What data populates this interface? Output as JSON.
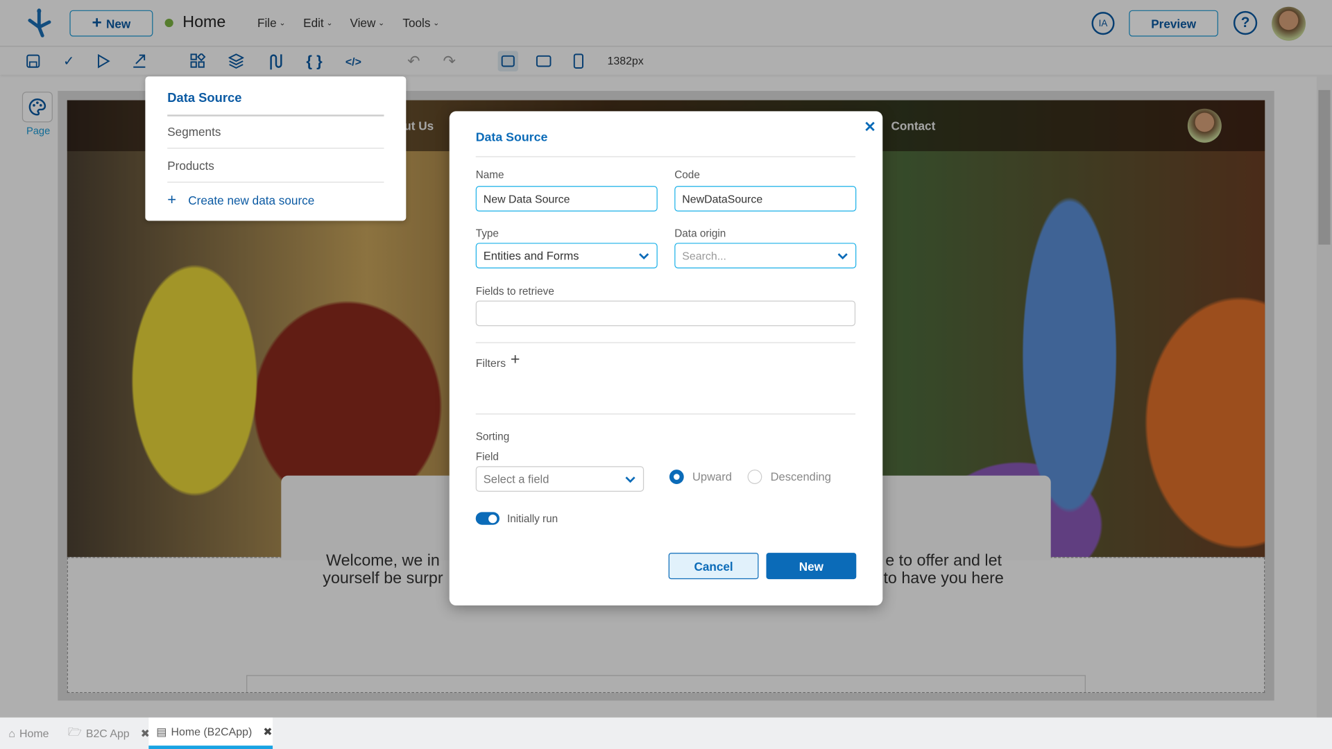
{
  "header": {
    "new_label": "New",
    "page_title": "Home",
    "status_color": "#7cb342",
    "menus": [
      "File",
      "Edit",
      "View",
      "Tools"
    ],
    "ia_label": "IA",
    "preview_label": "Preview"
  },
  "toolbar": {
    "width_readout": "1382px",
    "icons": [
      "save-icon",
      "check-icon",
      "play-icon",
      "export-icon",
      "components-icon",
      "layers-icon",
      "data-source-icon",
      "braces-icon",
      "code-icon",
      "undo-icon",
      "redo-icon",
      "desktop-icon",
      "tablet-icon",
      "mobile-icon"
    ]
  },
  "side": {
    "page_label": "Page"
  },
  "preview_page": {
    "nav_partial": "out Us",
    "nav_contact": "Contact",
    "welcome_left_1": "Welcome, we in",
    "welcome_left_2": "yourself be surpr",
    "welcome_right_1": "e to offer and let",
    "welcome_right_2": "to have you here"
  },
  "datasource_menu": {
    "title": "Data Source",
    "items": [
      "Segments",
      "Products"
    ],
    "create_label": "Create new data source"
  },
  "modal": {
    "title": "Data Source",
    "name_label": "Name",
    "name_value": "New Data Source",
    "code_label": "Code",
    "code_value": "NewDataSource",
    "type_label": "Type",
    "type_value": "Entities and Forms",
    "origin_label": "Data origin",
    "origin_placeholder": "Search...",
    "fields_label": "Fields to retrieve",
    "fields_value": "",
    "filters_label": "Filters",
    "sorting_label": "Sorting",
    "field_label": "Field",
    "field_placeholder": "Select a field",
    "upward_label": "Upward",
    "descending_label": "Descending",
    "sort_selected": "Upward",
    "initially_run_label": "Initially run",
    "initially_run": true,
    "cancel_label": "Cancel",
    "new_label": "New",
    "accent": "#0b6bb8"
  },
  "tabs": [
    {
      "label": "Home"
    },
    {
      "label": "B2C App"
    },
    {
      "label": "Home (B2CApp)",
      "active": true
    }
  ]
}
